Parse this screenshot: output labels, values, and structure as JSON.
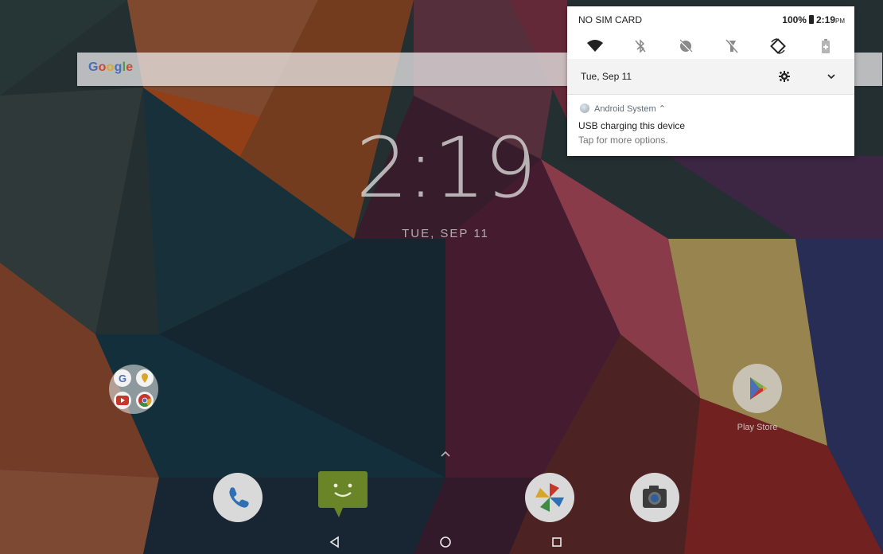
{
  "search": {
    "logo_letters": [
      "G",
      "o",
      "o",
      "g",
      "l",
      "e"
    ]
  },
  "lockscreen": {
    "time": "2:19",
    "date": "TUE, SEP 11"
  },
  "status_bar": {
    "carrier": "NO SIM CARD",
    "battery": "100%",
    "time": "2:19",
    "ampm": "PM"
  },
  "quick_settings": [
    {
      "icon": "wifi-icon"
    },
    {
      "icon": "bluetooth-off-icon"
    },
    {
      "icon": "do-not-disturb-icon"
    },
    {
      "icon": "flashlight-off-icon"
    },
    {
      "icon": "auto-rotate-icon"
    },
    {
      "icon": "battery-saver-icon"
    }
  ],
  "panel": {
    "date": "Tue, Sep 11"
  },
  "notification": {
    "app": "Android System",
    "title": "USB charging this device",
    "text": "Tap for more options."
  },
  "home": {
    "apps": [
      {
        "label": "Play Store",
        "icon": "play-store-icon"
      }
    ],
    "dock": [
      {
        "icon": "phone-icon"
      },
      {
        "icon": "messaging-icon"
      },
      {
        "icon": "photos-icon"
      },
      {
        "icon": "camera-icon"
      }
    ]
  },
  "colors": {
    "accent": "#7a9e2e",
    "panel_bg": "#ffffff"
  }
}
